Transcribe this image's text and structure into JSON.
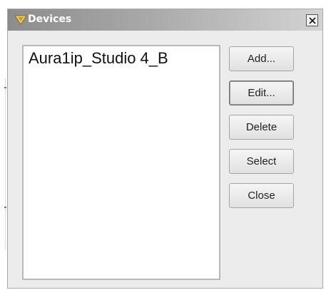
{
  "window": {
    "title": "Devices"
  },
  "devices": [
    {
      "name": "Aura1ip_Studio 4_B"
    }
  ],
  "buttons": {
    "add": "Add...",
    "edit": "Edit...",
    "delete": "Delete",
    "select": "Select",
    "close": "Close"
  },
  "icons": {
    "title": "v-logo-icon",
    "close": "close-icon"
  },
  "colors": {
    "titlebar_dark": "#8c8c8c",
    "titlebar_light": "#d3d3d3",
    "dialog_bg": "#ececec"
  }
}
